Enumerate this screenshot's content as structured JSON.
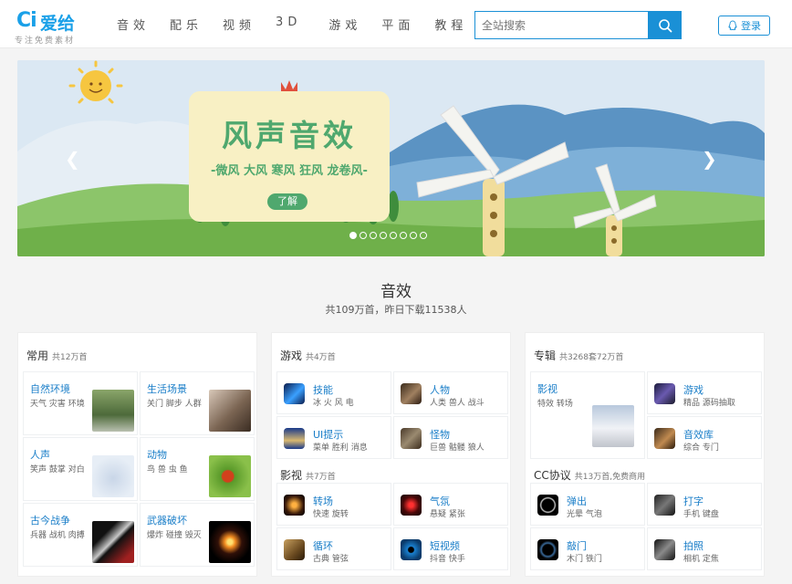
{
  "logo": {
    "mark": "Ci",
    "name": "爱给",
    "tagline": "专注免费素材"
  },
  "nav": [
    "音效",
    "配乐",
    "视频",
    "3D",
    "游戏",
    "平面",
    "教程"
  ],
  "search": {
    "placeholder": "全站搜索",
    "icon": "search-icon"
  },
  "login": {
    "label": "登录",
    "icon": "qq-icon"
  },
  "banner": {
    "title": "风声音效",
    "subtitle": "-微风 大风 寒风 狂风 龙卷风-",
    "button": "了解",
    "slide_count": 8,
    "active_slide": 1
  },
  "section": {
    "title": "音效",
    "summary": "共109万首，昨日下载11538人"
  },
  "columns": [
    {
      "groups": [
        {
          "title": "常用",
          "count": "共12万首",
          "items": [
            {
              "name": "自然环境",
              "tags": "天气 灾害 环境"
            },
            {
              "name": "生活场景",
              "tags": "关门 脚步 人群"
            },
            {
              "name": "人声",
              "tags": "笑声 鼓掌 对白"
            },
            {
              "name": "动物",
              "tags": "鸟 兽 虫 鱼"
            },
            {
              "name": "古今战争",
              "tags": "兵器 战机 肉搏"
            },
            {
              "name": "武器破坏",
              "tags": "爆炸 碰撞 毁灭"
            }
          ]
        }
      ]
    },
    {
      "groups": [
        {
          "title": "游戏",
          "count": "共4万首",
          "items": [
            {
              "name": "技能",
              "tags": "冰 火 风 电"
            },
            {
              "name": "人物",
              "tags": "人类 兽人 战斗"
            },
            {
              "name": "UI提示",
              "tags": "菜单 胜利 消息"
            },
            {
              "name": "怪物",
              "tags": "巨兽 骷髅 狼人"
            }
          ]
        },
        {
          "title": "影视",
          "count": "共7万首",
          "items": [
            {
              "name": "转场",
              "tags": "快速 旋转"
            },
            {
              "name": "气氛",
              "tags": "悬疑 紧张"
            },
            {
              "name": "循环",
              "tags": "古典 管弦"
            },
            {
              "name": "短视频",
              "tags": "抖音 快手"
            }
          ]
        }
      ]
    },
    {
      "groups": [
        {
          "title": "专辑",
          "count": "共3268套72万首",
          "items": [
            {
              "name": "影视",
              "tags": "特效 转场"
            },
            {
              "name": "游戏",
              "tags": "精品 源码抽取"
            },
            {
              "name": "音效库",
              "tags": "综合 专门"
            }
          ]
        },
        {
          "title": "CC协议",
          "count": "共13万首,免费商用",
          "items": [
            {
              "name": "弹出",
              "tags": "光晕 气泡"
            },
            {
              "name": "打字",
              "tags": "手机 键盘"
            },
            {
              "name": "敲门",
              "tags": "木门 铁门"
            },
            {
              "name": "拍照",
              "tags": "相机 定焦"
            }
          ]
        }
      ]
    }
  ]
}
